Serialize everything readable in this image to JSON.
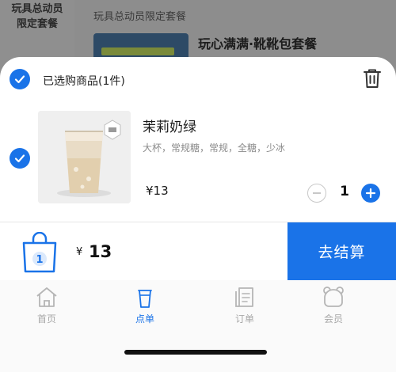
{
  "background": {
    "side_category": "玩具总动员\n限定套餐",
    "section_title": "玩具总动员限定套餐",
    "product_name": "玩心满满·靴靴包套餐"
  },
  "cart": {
    "header_label": "已选购商品(1件)",
    "item": {
      "name": "茉莉奶绿",
      "spec": "大杯，常规糖，常规，全糖，少冰",
      "price": "¥13",
      "quantity": "1",
      "selected": true
    },
    "bag_count": "1",
    "total_currency": "¥",
    "total_value": "13",
    "checkout_label": "去结算"
  },
  "tabs": [
    {
      "label": "首页",
      "icon": "home-icon",
      "active": false
    },
    {
      "label": "点单",
      "icon": "cup-icon",
      "active": true
    },
    {
      "label": "订单",
      "icon": "order-list-icon",
      "active": false
    },
    {
      "label": "会员",
      "icon": "member-bear-icon",
      "active": false
    }
  ],
  "colors": {
    "accent": "#1a73e8",
    "inactive": "#a8a8a8"
  }
}
